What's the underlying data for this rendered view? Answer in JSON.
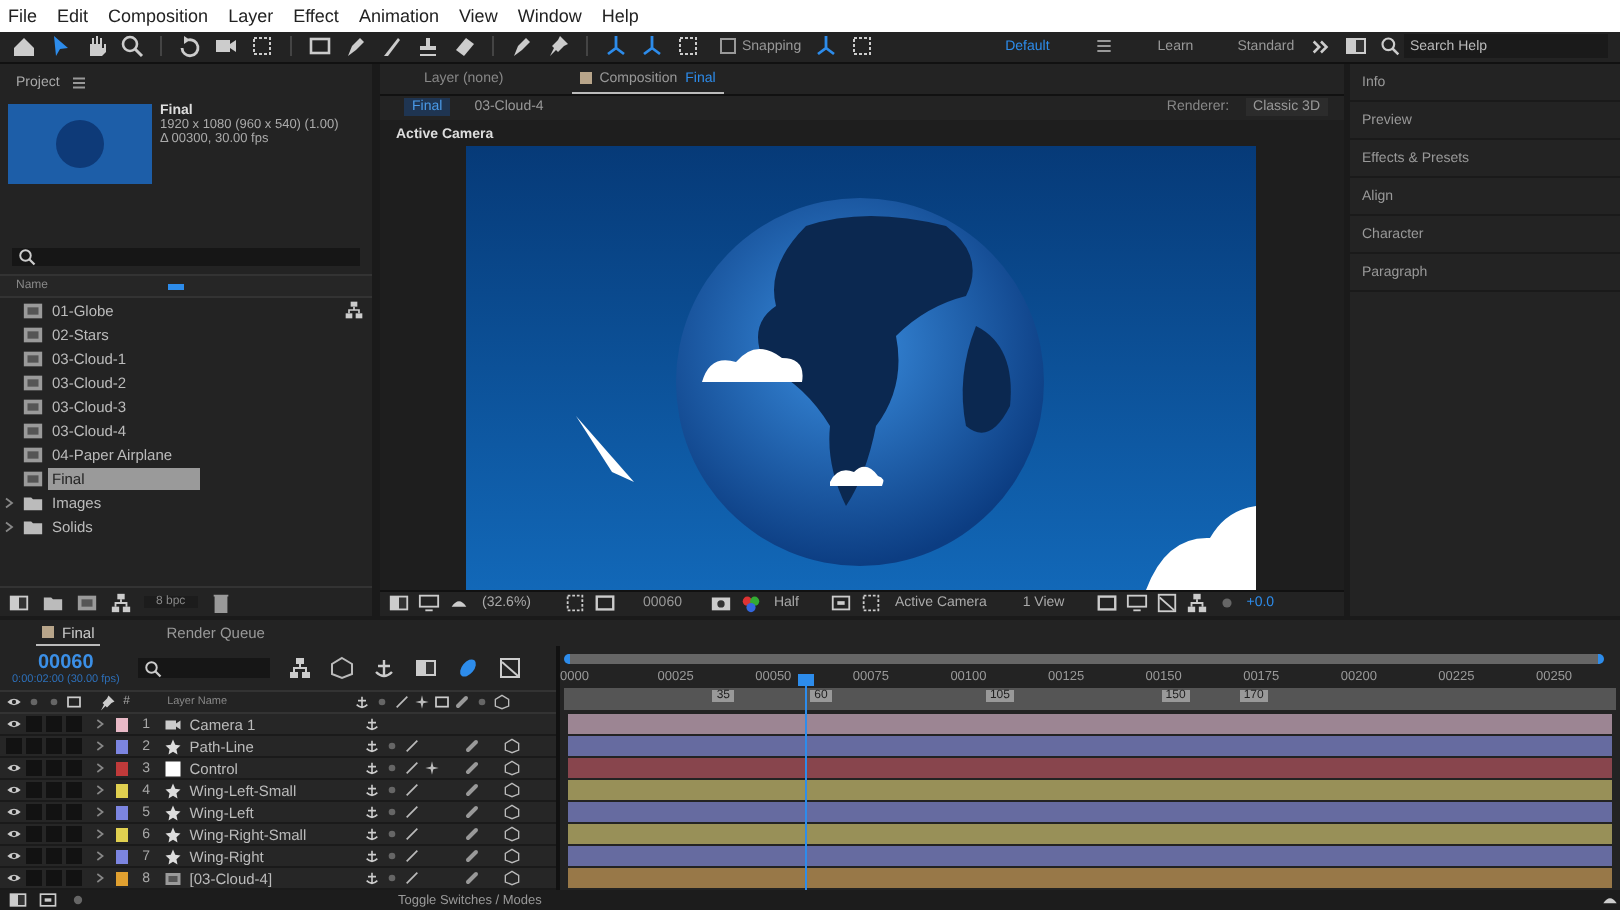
{
  "menu": [
    "File",
    "Edit",
    "Composition",
    "Layer",
    "Effect",
    "Animation",
    "View",
    "Window",
    "Help"
  ],
  "toolbar": {
    "snapping": {
      "label": "Snapping",
      "checked": false
    },
    "workspaces": [
      {
        "label": "Default",
        "selected": true
      },
      {
        "label": "Learn",
        "selected": false
      },
      {
        "label": "Standard",
        "selected": false
      }
    ],
    "search": {
      "placeholder": "Search Help"
    }
  },
  "project": {
    "title": "Project",
    "comp_name": "Final",
    "comp_info": [
      "1920 x 1080  (960 x 540) (1.00)",
      "Δ 00300, 30.00 fps"
    ],
    "column": "Name",
    "items": [
      {
        "name": "01-Globe",
        "kind": "comp",
        "selected": false
      },
      {
        "name": "02-Stars",
        "kind": "comp",
        "selected": false
      },
      {
        "name": "03-Cloud-1",
        "kind": "comp",
        "selected": false
      },
      {
        "name": "03-Cloud-2",
        "kind": "comp",
        "selected": false
      },
      {
        "name": "03-Cloud-3",
        "kind": "comp",
        "selected": false
      },
      {
        "name": "03-Cloud-4",
        "kind": "comp",
        "selected": false
      },
      {
        "name": "04-Paper Airplane",
        "kind": "comp",
        "selected": false
      },
      {
        "name": "Final",
        "kind": "comp",
        "selected": true
      },
      {
        "name": "Images",
        "kind": "folder",
        "selected": false
      },
      {
        "name": "Solids",
        "kind": "folder",
        "selected": false
      }
    ],
    "bpc": "8 bpc"
  },
  "viewer": {
    "tabs": [
      {
        "label": "Layer (none)",
        "selected": false
      },
      {
        "label": "Composition",
        "name": "Final",
        "selected": true
      }
    ],
    "breadcrumbs": [
      {
        "label": "Final",
        "selected": true
      },
      {
        "label": "03-Cloud-4",
        "selected": false
      }
    ],
    "renderer_label": "Renderer:",
    "renderer": "Classic 3D",
    "camera_label": "Active Camera",
    "zoom": "(32.6%)",
    "timecode": "00060",
    "resolution": "Half",
    "camera": "Active Camera",
    "views": "1 View",
    "exposure": "+0.0"
  },
  "panels": [
    "Info",
    "Preview",
    "Effects & Presets",
    "Align",
    "Character",
    "Paragraph"
  ],
  "timeline": {
    "tabs": [
      {
        "label": "Final",
        "selected": true
      },
      {
        "label": "Render Queue",
        "selected": false
      }
    ],
    "timecode": "00060",
    "timecode_sub": "0:00:02:00 (30.00 fps)",
    "col_number": "#",
    "col_name": "Layer Name",
    "ticks": [
      "0000",
      "00025",
      "00050",
      "00075",
      "00100",
      "00125",
      "00150",
      "00175",
      "00200",
      "00225",
      "00250"
    ],
    "markers": [
      "35",
      "60",
      "105",
      "150",
      "170"
    ],
    "layers": [
      {
        "number": "1",
        "name": "Camera 1",
        "kind": "camera",
        "color": "#e8b9c6",
        "visible": true,
        "effects": false
      },
      {
        "number": "2",
        "name": "Path-Line",
        "kind": "shape",
        "color": "#7c85e0",
        "visible": false,
        "effects": false
      },
      {
        "number": "3",
        "name": "Control",
        "kind": "solid",
        "color": "#c03a3a",
        "visible": true,
        "effects": true
      },
      {
        "number": "4",
        "name": "Wing-Left-Small",
        "kind": "shape",
        "color": "#e0d050",
        "visible": true,
        "effects": false
      },
      {
        "number": "5",
        "name": "Wing-Left",
        "kind": "shape",
        "color": "#7c85e0",
        "visible": true,
        "effects": false
      },
      {
        "number": "6",
        "name": "Wing-Right-Small",
        "kind": "shape",
        "color": "#e0d050",
        "visible": true,
        "effects": false
      },
      {
        "number": "7",
        "name": "Wing-Right",
        "kind": "shape",
        "color": "#7c85e0",
        "visible": true,
        "effects": false
      },
      {
        "number": "8",
        "name": "[03-Cloud-4]",
        "kind": "comp",
        "color": "#e0a030",
        "visible": true,
        "effects": false
      }
    ],
    "footer": "Toggle Switches / Modes"
  }
}
